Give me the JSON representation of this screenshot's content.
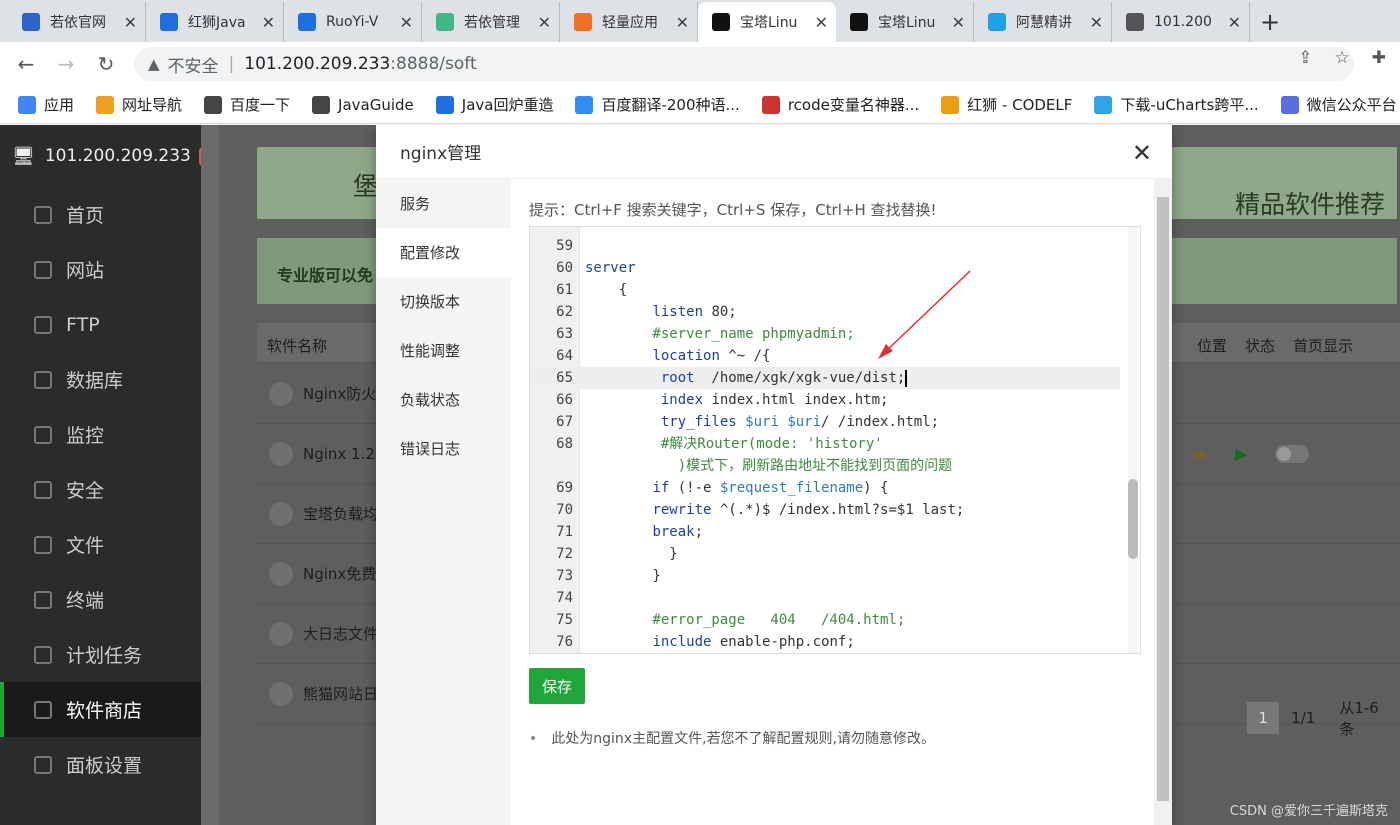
{
  "browser": {
    "tabs": [
      {
        "label": "若依官网",
        "icon": "paw-icon",
        "color": "#2f63c8"
      },
      {
        "label": "红狮Java",
        "icon": "doc-icon",
        "color": "#1f6fe0"
      },
      {
        "label": "RuoYi-V",
        "icon": "doc-icon",
        "color": "#1f6fe0"
      },
      {
        "label": "若依管理",
        "icon": "leaf-icon",
        "color": "#41b883"
      },
      {
        "label": "轻量应用",
        "icon": "bracket-icon",
        "color": "#f07028"
      },
      {
        "label": "宝塔Linu",
        "icon": "bt-icon",
        "color": "#111111",
        "active": true
      },
      {
        "label": "宝塔Linu",
        "icon": "bt-icon",
        "color": "#111111"
      },
      {
        "label": "阿慧精讲",
        "icon": "tv-icon",
        "color": "#20a0e8"
      },
      {
        "label": "101.200",
        "icon": "globe-icon",
        "color": "#555555"
      }
    ],
    "new_tab": "+",
    "address": {
      "insecure_label": "不安全",
      "host": "101.200.209.233",
      "path": ":8888/soft"
    },
    "bookmarks": [
      {
        "label": "应用",
        "icon": "apps-icon",
        "color": "#4285f4"
      },
      {
        "label": "网址导航",
        "icon": "ep-icon",
        "color": "#f0a020"
      },
      {
        "label": "百度一下",
        "icon": "globe-icon",
        "color": "#444444"
      },
      {
        "label": "JavaGuide",
        "icon": "globe-icon",
        "color": "#444444"
      },
      {
        "label": "Java回炉重造",
        "icon": "doc-icon",
        "color": "#1f6fe0"
      },
      {
        "label": "百度翻译-200种语...",
        "icon": "translate-icon",
        "color": "#2f8ff0"
      },
      {
        "label": "rcode变量名神器...",
        "icon": "rb-icon",
        "color": "#cc3333"
      },
      {
        "label": "红狮 - CODELF",
        "icon": "codelf-icon",
        "color": "#e8a010"
      },
      {
        "label": "下载-uCharts跨平...",
        "icon": "bird-icon",
        "color": "#2fa4e7"
      },
      {
        "label": "微信公众平台",
        "icon": "link-icon",
        "color": "#5b6ee1"
      }
    ]
  },
  "panel": {
    "server_ip": "101.200.209.233",
    "notice_count": "0",
    "menu": [
      "首页",
      "网站",
      "FTP",
      "数据库",
      "监控",
      "安全",
      "文件",
      "终端",
      "计划任务",
      "软件商店",
      "面板设置"
    ],
    "active_menu": "软件商店",
    "banner_left": "堡",
    "banner_right": "精品软件推荐",
    "pro_text": "专业版可以免",
    "table": {
      "name_header": "软件名称",
      "right_headers": [
        "位置",
        "状态",
        "首页显示"
      ],
      "rows": [
        {
          "name": "Nginx防火",
          "icon": "waf-icon"
        },
        {
          "name": "Nginx 1.2",
          "icon": "nginx-icon"
        },
        {
          "name": "宝塔负载均",
          "icon": "cluster-icon"
        },
        {
          "name": "Nginx免费",
          "icon": "waf-icon"
        },
        {
          "name": "大日志文件",
          "icon": "image-icon"
        },
        {
          "name": "熊猫网站日",
          "icon": "panda-icon"
        }
      ]
    },
    "pager": {
      "current": "1",
      "pages": "1/1",
      "range": "从1-6条"
    },
    "watermark": "CSDN @爱你三千遍斯塔克"
  },
  "modal": {
    "title": "nginx管理",
    "nav": [
      "服务",
      "配置修改",
      "切换版本",
      "性能调整",
      "负载状态",
      "错误日志"
    ],
    "active_nav": "配置修改",
    "tip": "提示：Ctrl+F 搜索关键字，Ctrl+S 保存，Ctrl+H 查找替换!",
    "save_label": "保存",
    "note": "此处为nginx主配置文件,若您不了解配置规则,请勿随意修改。",
    "code_lines": [
      {
        "n": "59",
        "text": ""
      },
      {
        "n": "60",
        "text": "server"
      },
      {
        "n": "61",
        "text": "    {"
      },
      {
        "n": "62",
        "text": "        listen 80;"
      },
      {
        "n": "63",
        "text": "        #server_name phpmyadmin;"
      },
      {
        "n": "64",
        "text": "        location ^~ /{"
      },
      {
        "n": "65",
        "text": "         root  /home/xgk/xgk-vue/dist;",
        "highlight": true
      },
      {
        "n": "66",
        "text": "         index index.html index.htm;"
      },
      {
        "n": "67",
        "text": "         try_files $uri $uri/ /index.html;"
      },
      {
        "n": "68",
        "text": "         #解决Router(mode: 'history'"
      },
      {
        "n": "",
        "text": "           )模式下，刷新路由地址不能找到页面的问题"
      },
      {
        "n": "69",
        "text": "        if (!-e $request_filename) {"
      },
      {
        "n": "70",
        "text": "        rewrite ^(.*)$ /index.html?s=$1 last;"
      },
      {
        "n": "71",
        "text": "        break;"
      },
      {
        "n": "72",
        "text": "          }"
      },
      {
        "n": "73",
        "text": "        }"
      },
      {
        "n": "74",
        "text": ""
      },
      {
        "n": "75",
        "text": "        #error_page   404   /404.html;"
      },
      {
        "n": "76",
        "text": "        include enable-php.conf;"
      }
    ]
  },
  "colors": {
    "accent_green": "#20a53a",
    "annotation_arrow": "#e03030"
  }
}
